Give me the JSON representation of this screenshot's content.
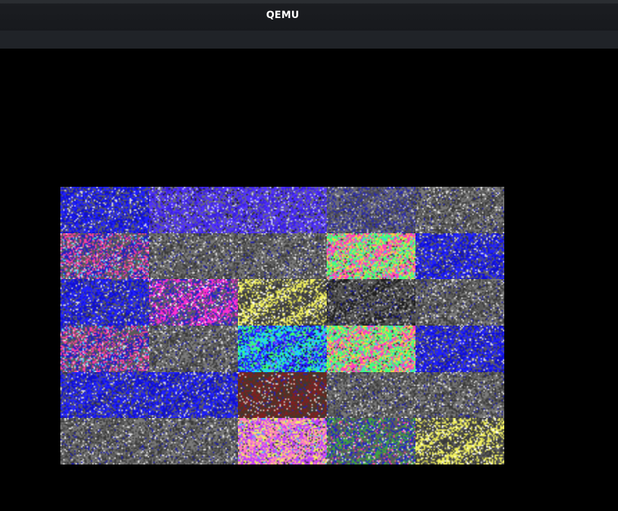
{
  "window": {
    "title": "QEMU"
  },
  "display": {
    "tiles": [
      "blue-noise",
      "violet-noise",
      "violet-noise",
      "slate-noise",
      "gray-noise",
      "mixed-noise",
      "gray-noise",
      "gray-noise",
      "rainbow-noise",
      "blue-noise",
      "blue-noise",
      "magenta-noise",
      "yellow-noise",
      "dark-noise",
      "gray-noise",
      "mixed-noise",
      "gray-noise",
      "cyan-noise",
      "rainbow-noise",
      "blue-noise",
      "blue-noise",
      "blue-noise",
      "brown-noise",
      "gray-noise",
      "gray-noise",
      "gray-noise",
      "gray-noise",
      "pink-noise",
      "green-noise",
      "yellow-noise"
    ],
    "palette": {
      "blue-noise": [
        "#1010d0",
        "#2020ff",
        "#5a5a6a",
        "#e0e0e0",
        "#303040"
      ],
      "violet-noise": [
        "#3a20e0",
        "#5030ff",
        "#6a6a7a",
        "#d0d0ff",
        "#202020"
      ],
      "slate-noise": [
        "#4a4a58",
        "#6a6a78",
        "#2a2ab0",
        "#c8c8d0",
        "#303030"
      ],
      "gray-noise": [
        "#5a5a5a",
        "#7a7a7a",
        "#3a3a3a",
        "#e8e8e8",
        "#1a1ab0"
      ],
      "mixed-noise": [
        "#2020c0",
        "#5a5a5a",
        "#ff40a0",
        "#e0e0e0",
        "#40d0ff"
      ],
      "rainbow-noise": [
        "#ff40c0",
        "#40ff80",
        "#ffd040",
        "#40c0ff",
        "#3a3a3a"
      ],
      "magenta-noise": [
        "#ff30d0",
        "#5a5a6a",
        "#2020d0",
        "#ffffff",
        "#802080"
      ],
      "yellow-noise": [
        "#f0f060",
        "#3a3a3a",
        "#5a5a5a",
        "#ffffff",
        "#c0c040"
      ],
      "dark-noise": [
        "#202020",
        "#4a4a4a",
        "#6a6a6a",
        "#d0d0d0",
        "#1010a0"
      ],
      "cyan-noise": [
        "#20d0ff",
        "#2020ff",
        "#40ff60",
        "#0a0a40",
        "#a040ff"
      ],
      "brown-noise": [
        "#5a3020",
        "#802020",
        "#3a3a3a",
        "#e0e0e0",
        "#2020c0"
      ],
      "pink-noise": [
        "#ff80c0",
        "#c040ff",
        "#f0f060",
        "#3a3a3a",
        "#40c0ff"
      ],
      "green-noise": [
        "#40a040",
        "#5a5a5a",
        "#2020d0",
        "#e0e0e0",
        "#ff40a0"
      ]
    }
  }
}
